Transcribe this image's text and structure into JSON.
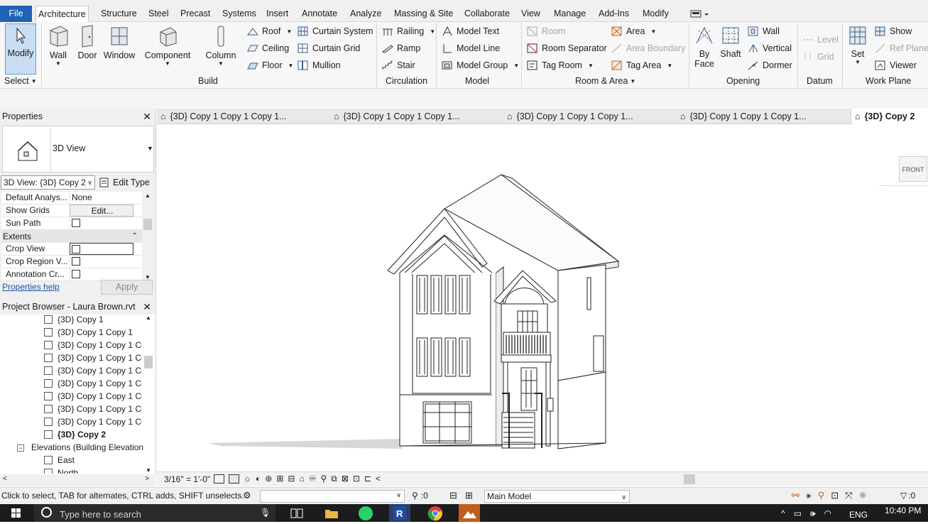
{
  "menubar": {
    "file": "File",
    "items": [
      "Architecture",
      "Structure",
      "Steel",
      "Precast",
      "Systems",
      "Insert",
      "Annotate",
      "Analyze",
      "Massing & Site",
      "Collaborate",
      "View",
      "Manage",
      "Add-Ins",
      "Modify"
    ]
  },
  "ribbon": {
    "select": {
      "modify": "Modify",
      "label": "Select"
    },
    "build": {
      "wall": "Wall",
      "door": "Door",
      "window": "Window",
      "component": "Component",
      "column": "Column",
      "roof": "Roof",
      "ceiling": "Ceiling",
      "floor": "Floor",
      "curtain_system": "Curtain System",
      "curtain_grid": "Curtain Grid",
      "mullion": "Mullion",
      "label": "Build"
    },
    "circulation": {
      "railing": "Railing",
      "ramp": "Ramp",
      "stair": "Stair",
      "label": "Circulation"
    },
    "model": {
      "model_text": "Model Text",
      "model_line": "Model Line",
      "model_group": "Model Group",
      "label": "Model"
    },
    "room_area": {
      "room": "Room",
      "room_separator": "Room Separator",
      "tag_room": "Tag Room",
      "area": "Area",
      "area_boundary": "Area Boundary",
      "tag_area": "Tag Area",
      "label": "Room & Area"
    },
    "opening": {
      "by_face_1": "By",
      "by_face_2": "Face",
      "shaft": "Shaft",
      "wall": "Wall",
      "vertical": "Vertical",
      "dormer": "Dormer",
      "label": "Opening"
    },
    "datum": {
      "level": "Level",
      "grid": "Grid",
      "label": "Datum"
    },
    "work_plane": {
      "set": "Set",
      "show": "Show",
      "ref_plane": "Ref Plane",
      "viewer": "Viewer",
      "label": "Work Plane"
    }
  },
  "properties": {
    "title": "Properties",
    "type_name": "3D View",
    "instance_selector": "3D View: {3D} Copy 2",
    "edit_type": "Edit Type",
    "rows": [
      {
        "key": "Default Analys...",
        "value": "None"
      },
      {
        "key": "Show Grids",
        "value": "Edit..."
      },
      {
        "key": "Sun Path",
        "value": ""
      }
    ],
    "section": "Extents",
    "rows2": [
      {
        "key": "Crop View",
        "value": ""
      },
      {
        "key": "Crop Region V...",
        "value": ""
      },
      {
        "key": "Annotation Cr...",
        "value": ""
      }
    ],
    "help_link": "Properties help",
    "apply": "Apply"
  },
  "browser": {
    "title": "Project Browser - Laura Brown.rvt",
    "items": [
      "{3D} Copy 1",
      "{3D} Copy 1 Copy 1",
      "{3D} Copy 1 Copy 1 Cc",
      "{3D} Copy 1 Copy 1 Cc",
      "{3D} Copy 1 Copy 1 Cc",
      "{3D} Copy 1 Copy 1 Cc",
      "{3D} Copy 1 Copy 1 Cc",
      "{3D} Copy 1 Copy 1 Cc",
      "{3D} Copy 1 Copy 1 Cc",
      "{3D} Copy 2"
    ],
    "group": "Elevations (Building Elevation",
    "elev_items": [
      "East",
      "North"
    ]
  },
  "tabs": [
    "{3D} Copy 1 Copy 1 Copy 1...",
    "{3D} Copy 1 Copy 1 Copy 1...",
    "{3D} Copy 1 Copy 1 Copy 1...",
    "{3D} Copy 1 Copy 1 Copy 1...",
    "{3D} Copy 2"
  ],
  "viewcube": "FRONT",
  "viewbar": {
    "scale": "3/16\" = 1'-0\""
  },
  "status": {
    "hint": "Click to select, TAB for alternates, CTRL adds, SHIFT unselects.",
    "count": ":0",
    "model": "Main Model",
    "filter": ":0"
  },
  "taskbar": {
    "search": "Type here to search",
    "lang": "ENG",
    "time": "10:40 PM"
  },
  "colors": {
    "accent": "#1e63b6",
    "taskbar": "#1c1c1e"
  }
}
